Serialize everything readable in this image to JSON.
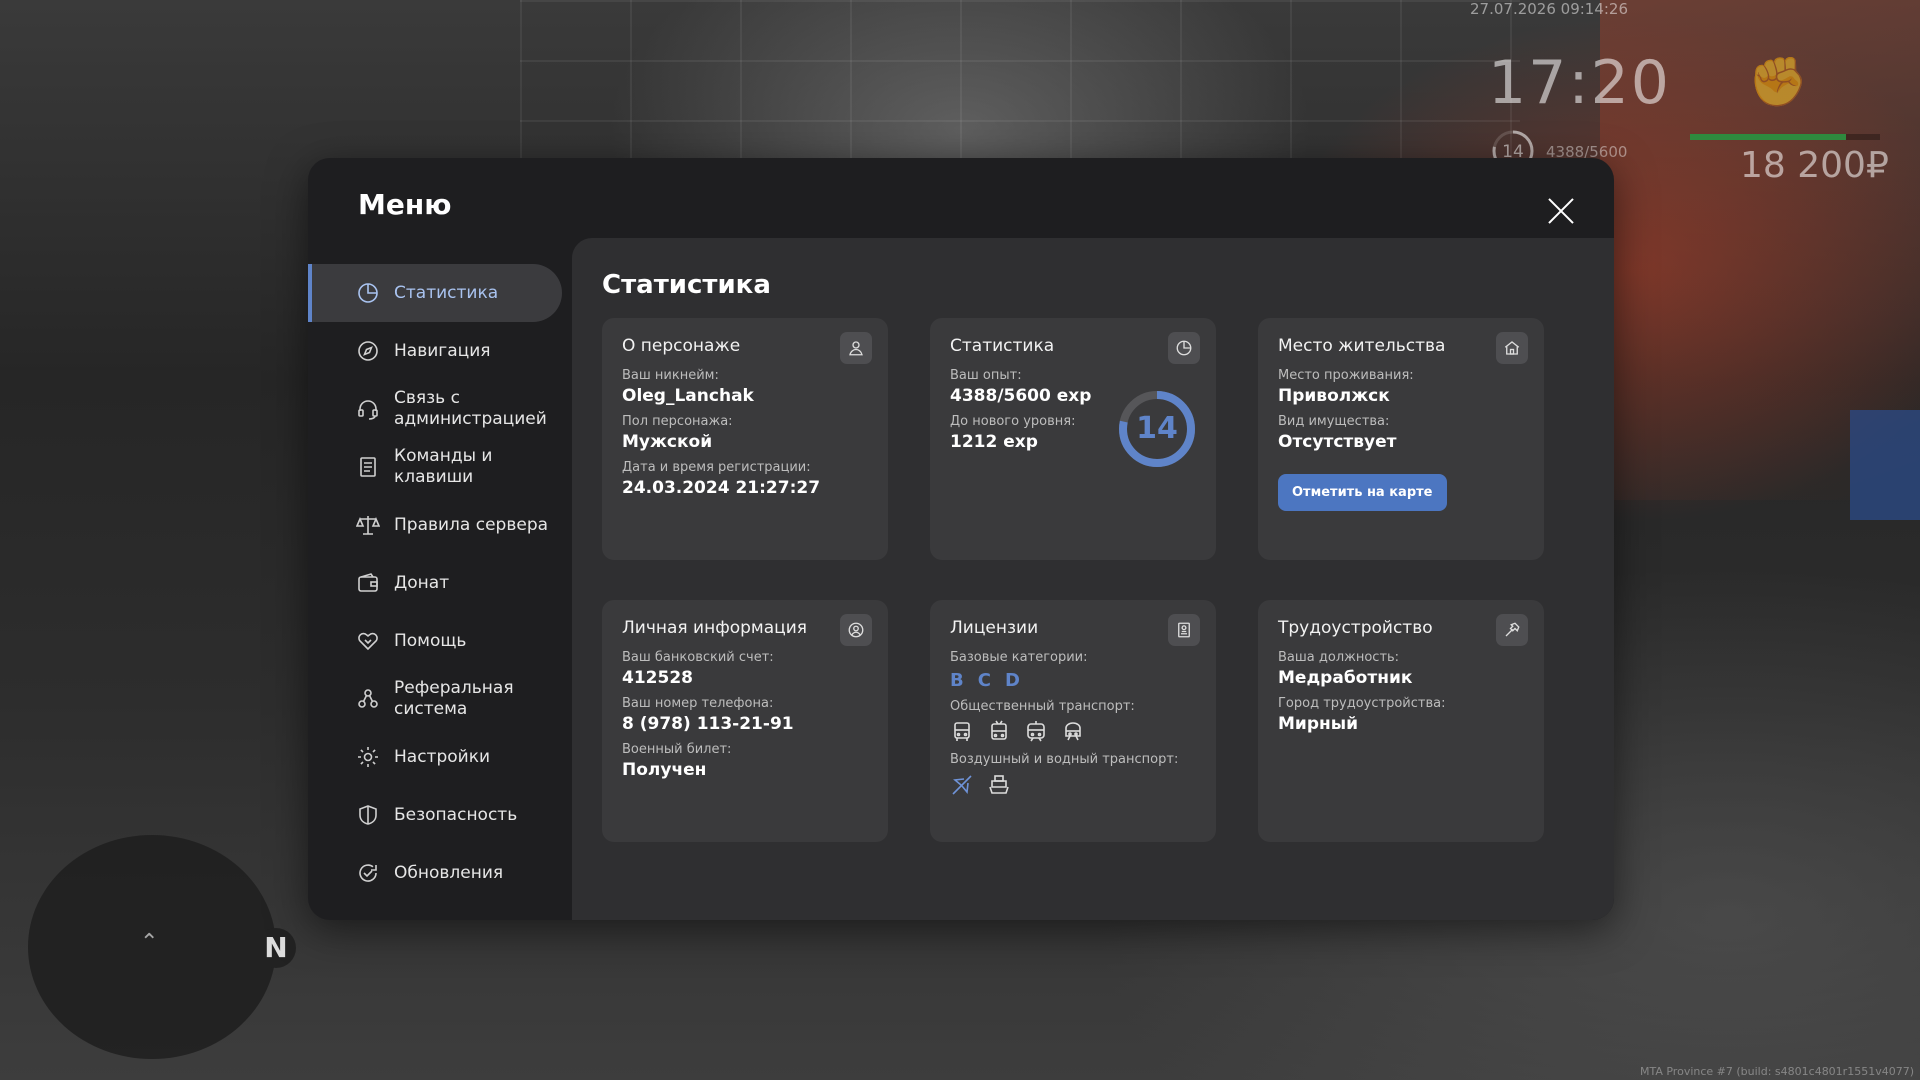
{
  "hud": {
    "datetime": "27.07.2026 09:14:26",
    "time": "17:20",
    "level": "14",
    "exp": "4388/5600",
    "money": "18 200₽",
    "health_fraction": 0.82,
    "build_info": "MTA Province #7 (build: s4801c4801r1551v4077)"
  },
  "radar": {
    "north_label": "N"
  },
  "menu": {
    "title": "Меню",
    "sidebar": [
      {
        "label": "Статистика",
        "icon": "pie-chart-icon",
        "active": true
      },
      {
        "label": "Навигация",
        "icon": "compass-icon"
      },
      {
        "label": "Связь с администрацией",
        "icon": "headset-icon"
      },
      {
        "label": "Команды и клавиши",
        "icon": "document-icon"
      },
      {
        "label": "Правила сервера",
        "icon": "scales-icon"
      },
      {
        "label": "Донат",
        "icon": "wallet-icon"
      },
      {
        "label": "Помощь",
        "icon": "handshake-icon"
      },
      {
        "label": "Реферальная система",
        "icon": "referral-icon"
      },
      {
        "label": "Настройки",
        "icon": "gear-icon"
      },
      {
        "label": "Безопасность",
        "icon": "shield-icon"
      },
      {
        "label": "Обновления",
        "icon": "refresh-check-icon"
      }
    ],
    "content_title": "Статистика",
    "cards": {
      "character": {
        "title": "О персонаже",
        "icon": "user-icon",
        "nickname_label": "Ваш никнейм:",
        "nickname": "Oleg_Lanchak",
        "gender_label": "Пол персонажа:",
        "gender": "Мужской",
        "reg_label": "Дата и время регистрации:",
        "reg_date": "24.03.2024 21:27:27"
      },
      "stats": {
        "title": "Статистика",
        "icon": "pie-chart-icon",
        "exp_label": "Ваш опыт:",
        "exp": "4388/5600 exp",
        "next_label": "До нового уровня:",
        "next": "1212 exp",
        "level": "14",
        "progress": 0.7836
      },
      "residence": {
        "title": "Место жительства",
        "icon": "house-icon",
        "place_label": "Место проживания:",
        "place": "Приволжск",
        "property_label": "Вид имущества:",
        "property": "Отсутствует",
        "map_button": "Отметить на карте"
      },
      "personal": {
        "title": "Личная информация",
        "icon": "user-circle-icon",
        "bank_label": "Ваш банковский счет:",
        "bank": "412528",
        "phone_label": "Ваш номер телефона:",
        "phone": "8 (978) 113-21-91",
        "military_label": "Военный билет:",
        "military": "Получен"
      },
      "licenses": {
        "title": "Лицензии",
        "icon": "id-card-icon",
        "base_label": "Базовые категории:",
        "categories": [
          "B",
          "C",
          "D"
        ],
        "public_label": "Общественный транспорт:",
        "air_label": "Воздушный и водный транспорт:"
      },
      "job": {
        "title": "Трудоустройство",
        "icon": "hammer-icon",
        "position_label": "Ваша должность:",
        "position": "Медработник",
        "city_label": "Город трудоустройства:",
        "city": "Мирный"
      }
    }
  },
  "colors": {
    "accent": "#5f84c9",
    "button": "#4c76c1",
    "window": "#1e1e20",
    "card": "#3a3a3c"
  }
}
